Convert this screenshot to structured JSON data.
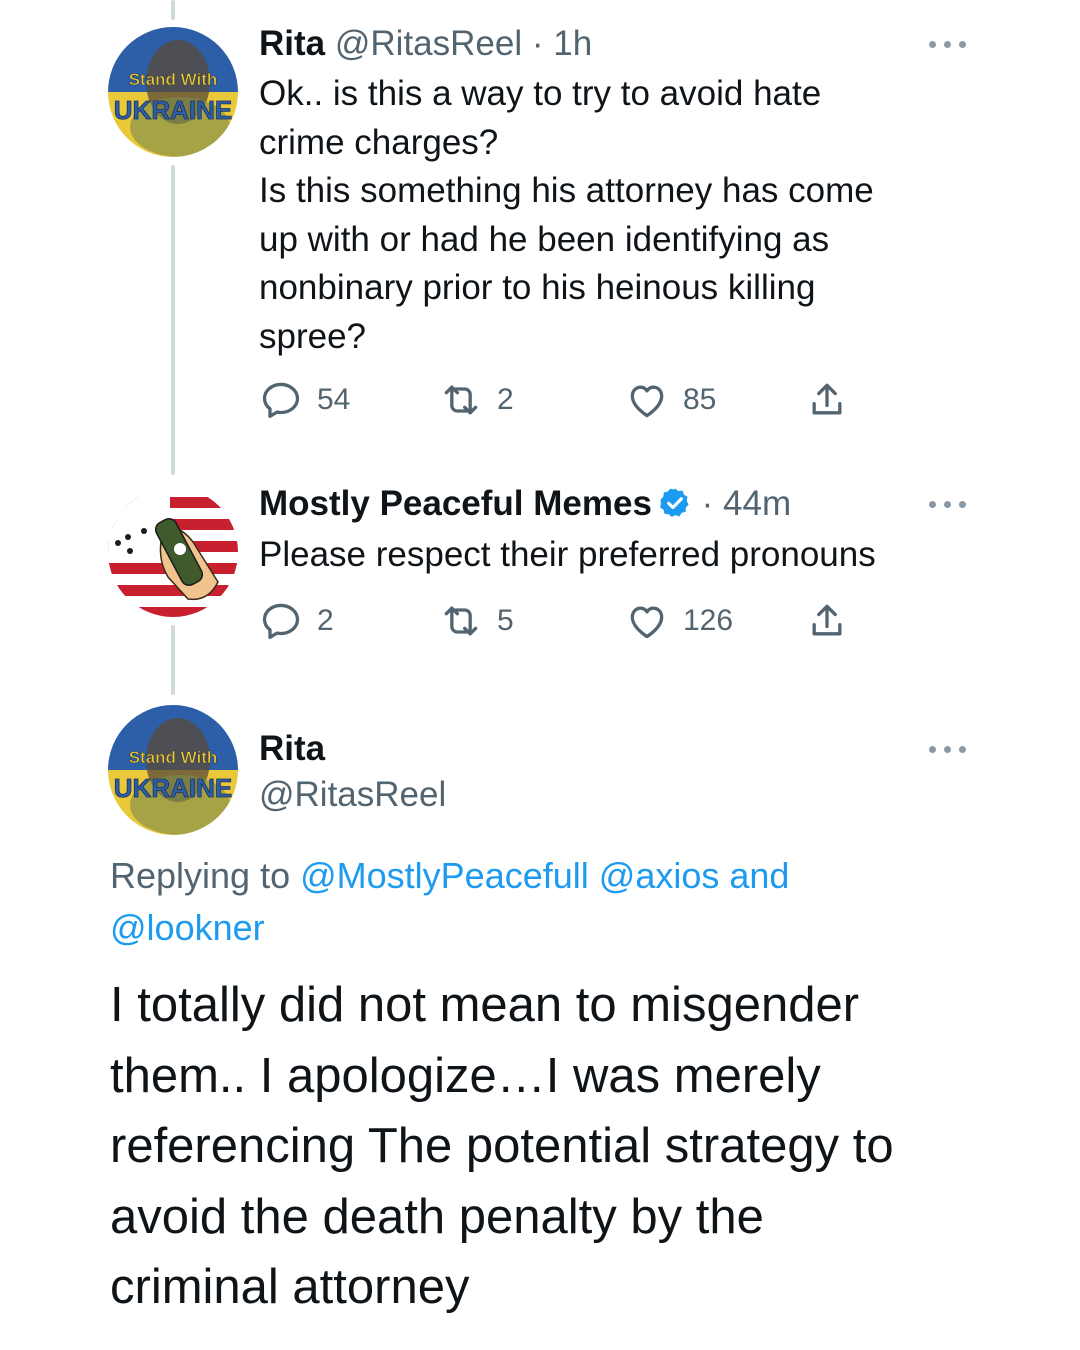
{
  "tweet1": {
    "name": "Rita",
    "handle": "@RitasReel",
    "time": "· 1h",
    "text": "Ok.. is this a way to try to avoid hate\ncrime charges?\nIs this something his attorney has come\nup with or had he been identifying as\nnonbinary prior to his heinous killing\nspree?",
    "avatar_text": [
      "Stand With",
      "UKRAINE"
    ],
    "replies": "54",
    "retweets": "2",
    "likes": "85"
  },
  "tweet2": {
    "name": "Mostly Peaceful Memes",
    "time": "· 44m",
    "text": "Please respect their preferred pronouns",
    "replies": "2",
    "retweets": "5",
    "likes": "126"
  },
  "tweet3": {
    "name": "Rita",
    "handle": "@RitasReel",
    "avatar_text": [
      "Stand With",
      "UKRAINE"
    ],
    "replying_prefix": "Replying to ",
    "reply_to_1": "@MostlyPeacefull",
    "reply_to_2": "@axios",
    "reply_and": " and",
    "reply_to_3": "@lookner",
    "text": "I totally did not mean to misgender\nthem.. I apologize…I was merely\nreferencing The potential strategy to\navoid the death penalty by the\ncriminal attorney"
  },
  "icons": {
    "reply": "reply-icon",
    "retweet": "retweet-icon",
    "like": "heart-icon",
    "share": "share-icon",
    "more": "more-icon",
    "verified": "verified-badge-icon"
  },
  "colors": {
    "link": "#1d9bf0",
    "muted": "#536471",
    "thread_line": "#cfd9de",
    "ukraine_blue": "#2d5fa8",
    "ukraine_yellow": "#e9c93a"
  }
}
